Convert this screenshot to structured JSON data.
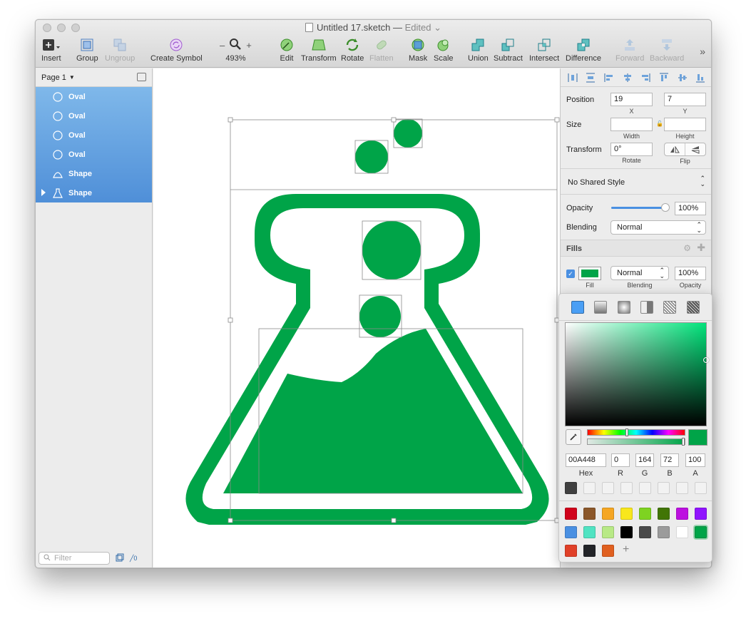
{
  "window": {
    "title": "Untitled 17.sketch",
    "dash": "—",
    "edited": "Edited"
  },
  "toolbar": {
    "insert": "Insert",
    "group": "Group",
    "ungroup": "Ungroup",
    "create_symbol": "Create Symbol",
    "zoom_minus": "–",
    "zoom_plus": "+",
    "zoom_level": "493%",
    "edit": "Edit",
    "transform": "Transform",
    "rotate": "Rotate",
    "flatten": "Flatten",
    "mask": "Mask",
    "scale": "Scale",
    "union": "Union",
    "subtract": "Subtract",
    "intersect": "Intersect",
    "difference": "Difference",
    "forward": "Forward",
    "backward": "Backward",
    "more": "»"
  },
  "sidebar": {
    "page": "Page 1",
    "layers": [
      {
        "name": "Oval",
        "icon": "oval-icon"
      },
      {
        "name": "Oval",
        "icon": "oval-icon"
      },
      {
        "name": "Oval",
        "icon": "oval-icon"
      },
      {
        "name": "Oval",
        "icon": "oval-icon"
      },
      {
        "name": "Shape",
        "icon": "shape-icon"
      },
      {
        "name": "Shape",
        "icon": "flask-icon"
      }
    ],
    "filter_placeholder": "Filter",
    "slice_count": "0"
  },
  "inspector": {
    "position_label": "Position",
    "x_value": "19",
    "y_value": "7",
    "x_label": "X",
    "y_label": "Y",
    "size_label": "Size",
    "width_value": "",
    "height_value": "",
    "width_label": "Width",
    "height_label": "Height",
    "transform_label": "Transform",
    "rotate_value": "0°",
    "rotate_label": "Rotate",
    "flip_label": "Flip",
    "shared_style": "No Shared Style",
    "opacity_label": "Opacity",
    "opacity_value": "100%",
    "opacity_level": 1.0,
    "blending_label": "Blending",
    "blending_value": "Normal",
    "fills_label": "Fills",
    "fill_enabled": true,
    "fill_color": "#00A448",
    "fill_blending": "Normal",
    "fill_opacity": "100%",
    "fill_sub_label": "Fill",
    "fill_blending_label": "Blending",
    "fill_opacity_label": "Opacity"
  },
  "color_picker": {
    "hex": "00A448",
    "r": "0",
    "g": "164",
    "b": "72",
    "a": "100",
    "hex_label": "Hex",
    "r_label": "R",
    "g_label": "G",
    "b_label": "B",
    "a_label": "A",
    "document_colors": [
      "#404040"
    ],
    "global_colors": [
      "#D0021B",
      "#8B572A",
      "#F5A623",
      "#F8E71C",
      "#7ED321",
      "#417505",
      "#BD10E0",
      "#9013FE",
      "#4A90E2",
      "#50E3C2",
      "#B8E986",
      "#000000",
      "#4A4A4A",
      "#9B9B9B",
      "#FFFFFF",
      "#00A448",
      "#E04028",
      "#222428",
      "#E06020"
    ],
    "add_label": "+"
  },
  "colors": {
    "brand_green": "#00A448",
    "selection_blue": "#4F8FD8"
  }
}
